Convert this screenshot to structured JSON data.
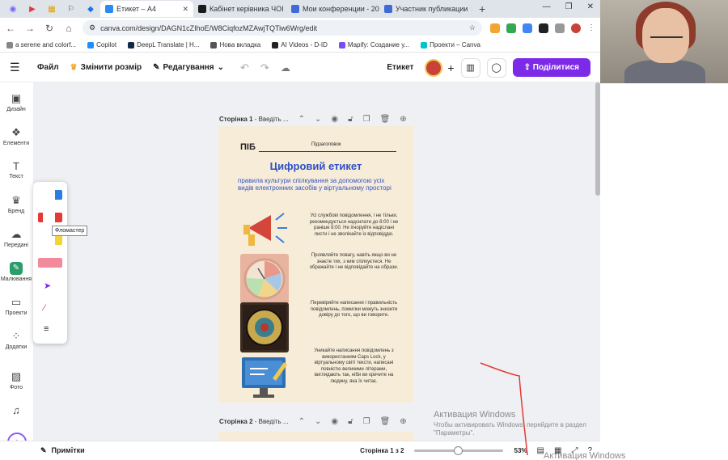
{
  "browser": {
    "tabs": [
      {
        "label": "Етикет – A4",
        "active": true,
        "color": "#2c8bf0"
      },
      {
        "label": "Кабінет керівника ЧОІ",
        "active": false,
        "color": "#1a1a1a"
      },
      {
        "label": "Мои конференции - 20",
        "active": false,
        "color": "#3f6ad8"
      },
      {
        "label": "Участник публикации",
        "active": false,
        "color": "#3f6ad8"
      }
    ],
    "url": "canva.com/design/DAGN1cZIhoE/W8CiqfozMZAwjTQTiw6Wrg/edit",
    "bookmarks": [
      {
        "label": "a serene and colorf...",
        "color": "#888"
      },
      {
        "label": "Copilot",
        "color": "#1f8fff"
      },
      {
        "label": "DeepL Translate | H...",
        "color": "#0f2b46"
      },
      {
        "label": "Нова вкладка",
        "color": "#555"
      },
      {
        "label": "AI Videos - D-ID",
        "color": "#222"
      },
      {
        "label": "Mapify: Создание у...",
        "color": "#7d4bf0"
      },
      {
        "label": "Проекти – Canva",
        "color": "#00c4cc"
      }
    ]
  },
  "canva_header": {
    "file_label": "Файл",
    "resize_label": "Змінити розмір",
    "edit_label": "Редагування",
    "doc_title": "Етикет",
    "share_label": "Поділитися"
  },
  "sidebar": {
    "items": [
      {
        "label": "Дизайн",
        "icon": "▣"
      },
      {
        "label": "Елементи",
        "icon": "❖"
      },
      {
        "label": "Текст",
        "icon": "T"
      },
      {
        "label": "Бренд",
        "icon": "♛"
      },
      {
        "label": "Передані",
        "icon": "☁"
      },
      {
        "label": "Малювання",
        "icon": "✎"
      },
      {
        "label": "Проекти",
        "icon": "▭"
      },
      {
        "label": "Додатки",
        "icon": "⁘"
      },
      {
        "label": "Фото",
        "icon": "▨"
      },
      {
        "label": "",
        "icon": "♫"
      }
    ]
  },
  "draw_panel": {
    "tooltip": "Фломастер",
    "pen_colors": [
      "#2a7de1",
      "#e53935",
      "#f2d43a",
      "#f28a9c"
    ]
  },
  "pages": {
    "page1_label": "Сторінка 1",
    "page1_title_placeholder": "Введіть ...",
    "page2_label": "Сторінка 2",
    "page2_title_placeholder": "Введіть ..."
  },
  "design": {
    "pib": "ПІБ",
    "subtitle": "Підзаголовок",
    "title": "Цифровий етикет",
    "lead": "правила культури спілкування за допомогою усіх видів електронних засобів у віртуальному просторі",
    "items": [
      {
        "text": "Усі службові повідомлення, і не тільки, рекомендується надсилати до 8:00 і не раніше 8:00. Не ігноруйте надіслані листи і не зволікайте із відповіддю."
      },
      {
        "text": "Проявляйте повагу, навіть якщо ви не знаєте тих, з ким спілкуєтеся. Не ображайте і не відповідайте на образи."
      },
      {
        "text": "Перевіряйте написання і правильність повідомлень, помилки можуть знизити довіру до того, що ви говорите."
      },
      {
        "text": "Уникайте написання повідомлень з використанням Caps Lock, у віртуальному світі тексти, написані повністю великими літерами, виглядають так, ніби ви кричите на людину, яка їх читає."
      }
    ]
  },
  "bottom_bar": {
    "notes_label": "Примітки",
    "pager": "Сторінка 1 з 2",
    "zoom": "53%",
    "zoom_level": 0.45
  },
  "windows_watermark": {
    "title": "Активация Windows",
    "subtitle": "Чтобы активировать Windows, перейдите в раздел \"Параметры\".",
    "title_repeat": "Активация Windows"
  }
}
